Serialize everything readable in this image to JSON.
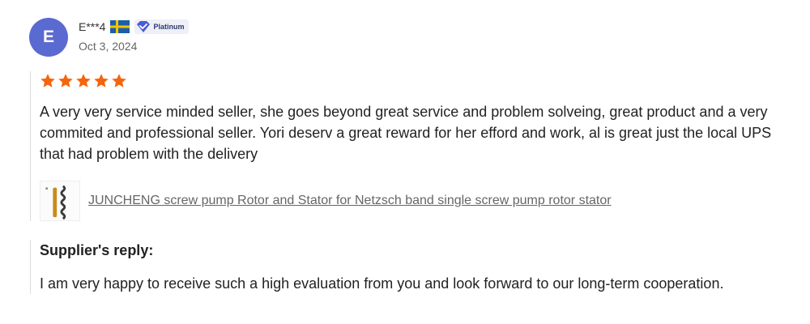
{
  "reviewer": {
    "initial": "E",
    "name": "E***4",
    "country_flag": "sweden-flag-icon",
    "badge_label": "Platinum",
    "date": "Oct 3, 2024"
  },
  "rating": {
    "stars": 5,
    "max": 5,
    "star_color": "#f5650d"
  },
  "review": {
    "text": "A very very service minded seller, she goes beyond great service and problem solveing, great product and a very commited and professional seller. Yori deserv a great reward for her efford and work, al is great just the local UPS that had problem with the delivery"
  },
  "product": {
    "link_text": "JUNCHENG screw pump Rotor and Stator for Netzsch band single screw pump rotor stator"
  },
  "supplier_reply": {
    "title": "Supplier's reply:",
    "text": "I am very happy to receive such a high evaluation from you and look forward to our long-term cooperation."
  },
  "colors": {
    "avatar_bg": "#5b6ad0",
    "badge_icon": "#4a5bd6",
    "link": "#666666"
  }
}
